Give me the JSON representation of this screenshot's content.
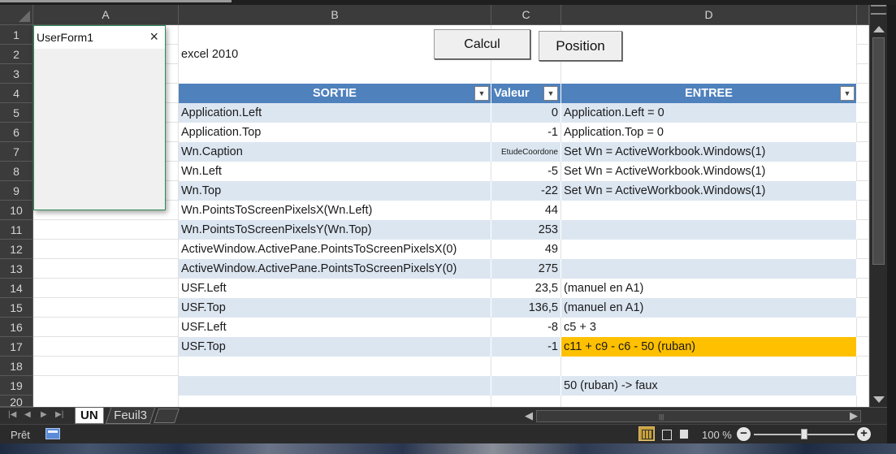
{
  "columns": [
    "A",
    "B",
    "C",
    "D"
  ],
  "rows": [
    "1",
    "2",
    "3",
    "4",
    "5",
    "6",
    "7",
    "8",
    "9",
    "10",
    "11",
    "12",
    "13",
    "14",
    "15",
    "16",
    "17",
    "18",
    "19",
    "20"
  ],
  "buttons": {
    "calcul": "Calcul",
    "position": "Position"
  },
  "userform": {
    "title": "UserForm1",
    "close": "×"
  },
  "cells": {
    "b2": "excel 2010",
    "b19": "",
    "d19": "50 (ruban) -> faux"
  },
  "table": {
    "headers": {
      "sortie": "SORTIE",
      "valeur": "Valeur",
      "entree": "ENTREE"
    },
    "rows": [
      {
        "sortie": "Application.Left",
        "valeur": "0",
        "entree": "Application.Left = 0"
      },
      {
        "sortie": "Application.Top",
        "valeur": "-1",
        "entree": "Application.Top = 0"
      },
      {
        "sortie": "Wn.Caption",
        "valeur": "EtudeCoordone",
        "entree": "Set Wn = ActiveWorkbook.Windows(1)"
      },
      {
        "sortie": "Wn.Left",
        "valeur": "-5",
        "entree": "Set Wn = ActiveWorkbook.Windows(1)"
      },
      {
        "sortie": "Wn.Top",
        "valeur": "-22",
        "entree": "Set Wn = ActiveWorkbook.Windows(1)"
      },
      {
        "sortie": "Wn.PointsToScreenPixelsX(Wn.Left)",
        "valeur": "44",
        "entree": ""
      },
      {
        "sortie": "Wn.PointsToScreenPixelsY(Wn.Top)",
        "valeur": "253",
        "entree": ""
      },
      {
        "sortie": "ActiveWindow.ActivePane.PointsToScreenPixelsX(0)",
        "valeur": "49",
        "entree": ""
      },
      {
        "sortie": "ActiveWindow.ActivePane.PointsToScreenPixelsY(0)",
        "valeur": "275",
        "entree": ""
      },
      {
        "sortie": "USF.Left",
        "valeur": "23,5",
        "entree": "(manuel en A1)"
      },
      {
        "sortie": "USF.Top",
        "valeur": "136,5",
        "entree": "(manuel en A1)"
      },
      {
        "sortie": "USF.Left",
        "valeur": "-8",
        "entree": "c5 + 3"
      },
      {
        "sortie": "USF.Top",
        "valeur": "-1",
        "entree": "c11 + c9 - c6 - 50 (ruban)"
      }
    ]
  },
  "highlight_color": "#ffc000",
  "table_header_color": "#4f81bd",
  "table_band_color": "#dce6f1",
  "tabs": [
    {
      "label": "UN",
      "active": true
    },
    {
      "label": "Feuil3",
      "active": false
    }
  ],
  "status": {
    "ready": "Prêt",
    "zoom": "100 %",
    "zoom_minus": "−",
    "zoom_plus": "+"
  },
  "icons": {
    "close": "close-icon",
    "dropdown": "dropdown-arrow-icon",
    "macro": "macro-record-icon",
    "new_sheet": "new-sheet-icon"
  }
}
